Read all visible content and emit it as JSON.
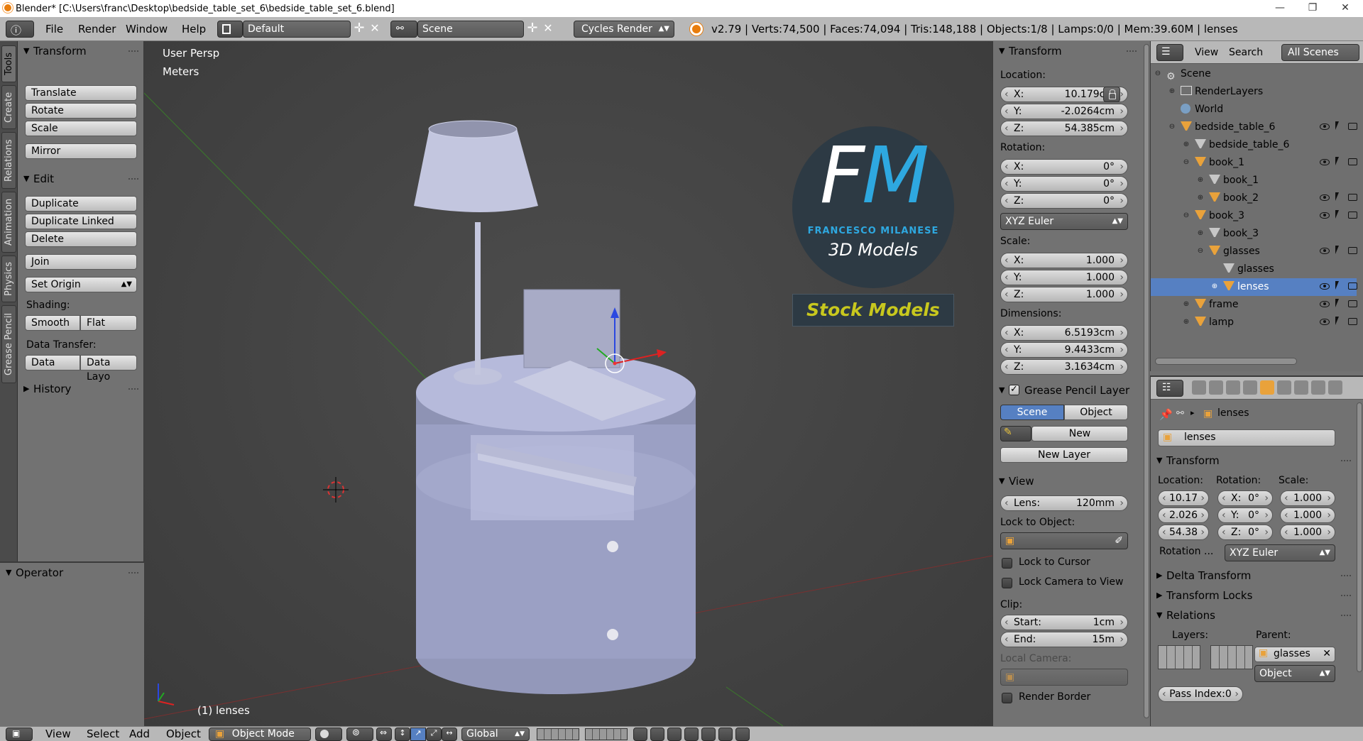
{
  "window": {
    "title": "Blender* [C:\\Users\\franc\\Desktop\\bedside_table_set_6\\bedside_table_set_6.blend]",
    "controls": [
      "—",
      "❐",
      "✕"
    ]
  },
  "info_header": {
    "menus": [
      "File",
      "Render",
      "Window",
      "Help"
    ],
    "layout": "Default",
    "scene": "Scene",
    "engine": "Cycles Render",
    "stats": "v2.79 | Verts:74,500 | Faces:74,094 | Tris:148,188 | Objects:1/8 | Lamps:0/0 | Mem:39.60M | lenses"
  },
  "tool_tabs": [
    "Tools",
    "Create",
    "Relations",
    "Animation",
    "Physics",
    "Grease Pencil"
  ],
  "tool_shelf": {
    "transform_header": "Transform",
    "translate": "Translate",
    "rotate": "Rotate",
    "scale": "Scale",
    "mirror": "Mirror",
    "edit_header": "Edit",
    "duplicate": "Duplicate",
    "duplicate_linked": "Duplicate Linked",
    "delete": "Delete",
    "join": "Join",
    "set_origin": "Set Origin",
    "shading_label": "Shading:",
    "smooth": "Smooth",
    "flat": "Flat",
    "data_transfer_label": "Data Transfer:",
    "data": "Data",
    "data_layout": "Data Layo",
    "history_header": "History",
    "operator_header": "Operator"
  },
  "viewport": {
    "view_name": "User Persp",
    "units": "Meters",
    "selected_label": "(1) lenses",
    "logo": {
      "initials": "FM",
      "name": "FRANCESCO MILANESE",
      "tagline": "3D Models",
      "banner": "Stock Models"
    }
  },
  "n_panel": {
    "transform_header": "Transform",
    "location_label": "Location:",
    "location": [
      {
        "axis": "X:",
        "value": "10.179cm"
      },
      {
        "axis": "Y:",
        "value": "-2.0264cm"
      },
      {
        "axis": "Z:",
        "value": "54.385cm"
      }
    ],
    "rotation_label": "Rotation:",
    "rotation": [
      {
        "axis": "X:",
        "value": "0°"
      },
      {
        "axis": "Y:",
        "value": "0°"
      },
      {
        "axis": "Z:",
        "value": "0°"
      }
    ],
    "rotation_mode": "XYZ Euler",
    "scale_label": "Scale:",
    "scale": [
      {
        "axis": "X:",
        "value": "1.000"
      },
      {
        "axis": "Y:",
        "value": "1.000"
      },
      {
        "axis": "Z:",
        "value": "1.000"
      }
    ],
    "dimensions_label": "Dimensions:",
    "dimensions": [
      {
        "axis": "X:",
        "value": "6.5193cm"
      },
      {
        "axis": "Y:",
        "value": "9.4433cm"
      },
      {
        "axis": "Z:",
        "value": "3.1634cm"
      }
    ],
    "grease_header": "Grease Pencil Layer",
    "gp_scene": "Scene",
    "gp_object": "Object",
    "gp_new": "New",
    "gp_new_layer": "New Layer",
    "view_header": "View",
    "lens_label": "Lens:",
    "lens_value": "120mm",
    "lock_to_object": "Lock to Object:",
    "lock_to_cursor": "Lock to Cursor",
    "lock_camera": "Lock Camera to View",
    "clip_label": "Clip:",
    "clip_start_label": "Start:",
    "clip_start": "1cm",
    "clip_end_label": "End:",
    "clip_end": "15m",
    "local_camera": "Local Camera:",
    "render_border": "Render Border"
  },
  "outliner": {
    "view": "View",
    "search": "Search",
    "filter": "All Scenes",
    "items": [
      {
        "label": "Scene"
      },
      {
        "label": "RenderLayers"
      },
      {
        "label": "World"
      },
      {
        "label": "bedside_table_6"
      },
      {
        "label": "bedside_table_6"
      },
      {
        "label": "book_1"
      },
      {
        "label": "book_1"
      },
      {
        "label": "book_2"
      },
      {
        "label": "book_3"
      },
      {
        "label": "book_3"
      },
      {
        "label": "glasses"
      },
      {
        "label": "glasses"
      },
      {
        "label": "lenses"
      },
      {
        "label": "frame"
      },
      {
        "label": "lamp"
      }
    ]
  },
  "properties": {
    "breadcrumb_object": "lenses",
    "object_name": "lenses",
    "transform_header": "Transform",
    "location_label": "Location:",
    "rotation_label": "Rotation:",
    "scale_label": "Scale:",
    "loc": [
      "10.17",
      "2.026",
      "54.38"
    ],
    "rot": [
      {
        "axis": "X:",
        "value": "0°"
      },
      {
        "axis": "Y:",
        "value": "0°"
      },
      {
        "axis": "Z:",
        "value": "0°"
      }
    ],
    "scl": [
      "1.000",
      "1.000",
      "1.000"
    ],
    "rotation_mode_label": "Rotation ...",
    "rotation_mode": "XYZ Euler",
    "delta_transform": "Delta Transform",
    "transform_locks": "Transform Locks",
    "relations": "Relations",
    "layers_label": "Layers:",
    "parent_label": "Parent:",
    "parent_value": "glasses",
    "parent_type": "Object",
    "pass_index": "Pass Index:0"
  },
  "bottom_header": {
    "view": "View",
    "select": "Select",
    "add": "Add",
    "object": "Object",
    "mode": "Object Mode",
    "orientation": "Global"
  },
  "colors": {
    "selected_blue": "#5680c2",
    "object_orange": "#e9a23b",
    "logo_blue": "#2ea8e0",
    "logo_yellow": "#c8c81e"
  }
}
